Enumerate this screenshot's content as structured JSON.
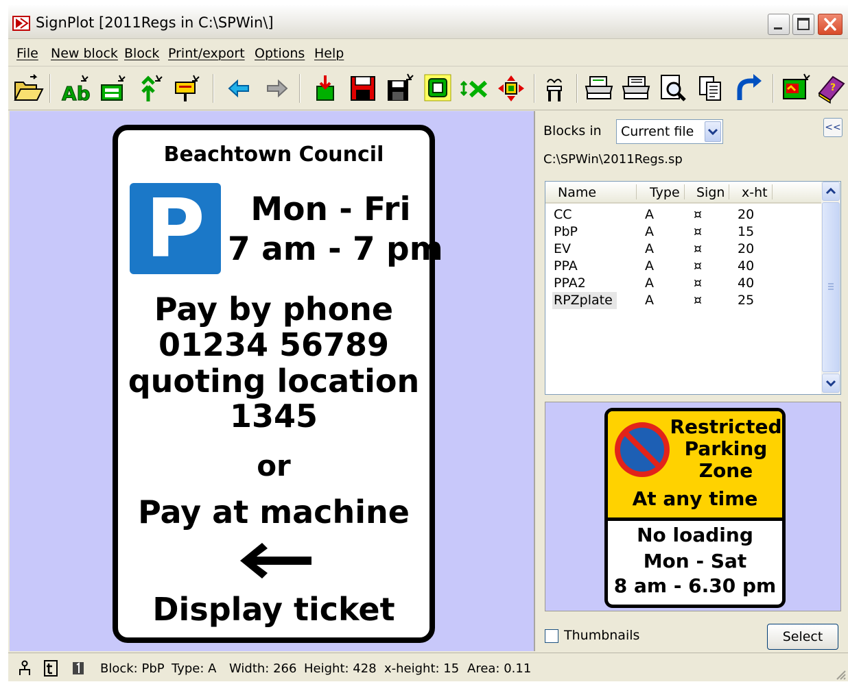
{
  "window": {
    "title": "SignPlot  [2011Regs  in C:\\SPWin\\]"
  },
  "menu": {
    "items": [
      "File",
      "New block",
      "Block",
      "Print/export",
      "Options",
      "Help"
    ]
  },
  "toolbar": {
    "icons": [
      "open-folder-icon",
      "new-text-icon",
      "new-panel-icon",
      "new-symbol-icon",
      "new-sign-icon",
      "back-arrow-icon",
      "forward-arrow-icon",
      "import-icon",
      "save-icon",
      "save-as-icon",
      "block-frame-icon",
      "delete-icon",
      "move-icon",
      "pillar-icon",
      "print-icon",
      "print-setup-icon",
      "print-preview-icon",
      "copy-icon",
      "redo-icon",
      "export-image-icon",
      "help-book-icon"
    ]
  },
  "sign": {
    "header": "Beachtown Council",
    "p_letter": "P",
    "days": "Mon - Fri",
    "hours": "7 am - 7 pm",
    "line1": "Pay by phone",
    "line2": "01234 56789",
    "line3": "quoting location",
    "line4": "1345",
    "line5": "or",
    "line6": "Pay at machine",
    "line7": "Display ticket"
  },
  "blocks_panel": {
    "label": "Blocks in",
    "source": "Current file",
    "path": "C:\\SPWin\\2011Regs.sp",
    "columns": [
      "Name",
      "Type",
      "Sign",
      "x-ht"
    ],
    "rows": [
      {
        "name": "CC",
        "type": "A",
        "sign": "¤",
        "xht": "20"
      },
      {
        "name": "PbP",
        "type": "A",
        "sign": "¤",
        "xht": "15"
      },
      {
        "name": "EV",
        "type": "A",
        "sign": "¤",
        "xht": "20"
      },
      {
        "name": "PPA",
        "type": "A",
        "sign": "¤",
        "xht": "40"
      },
      {
        "name": "PPA2",
        "type": "A",
        "sign": "¤",
        "xht": "40"
      },
      {
        "name": "RPZplate",
        "type": "A",
        "sign": "¤",
        "xht": "25"
      }
    ],
    "selected_row": 5,
    "thumbnails_label": "Thumbnails",
    "thumbnails_checked": false,
    "select_label": "Select",
    "collapse_label": "<<"
  },
  "preview_sign": {
    "line1": "Restricted",
    "line2": "Parking",
    "line3": "Zone",
    "line4": "At any time",
    "line5": "No loading",
    "line6": "Mon - Sat",
    "line7": "8 am - 6.30 pm"
  },
  "status": {
    "block": "Block: PbP",
    "type": "Type: A",
    "width": "Width: 266",
    "height": "Height: 428",
    "xheight": "x-height: 15",
    "area": "Area: 0.11"
  },
  "colors": {
    "canvas": "#c8c8fa",
    "parking_blue": "#1b78c8",
    "restricted_yellow": "#ffd200",
    "no_parking_red": "#e2231a",
    "no_parking_blue": "#1d5fb4"
  }
}
